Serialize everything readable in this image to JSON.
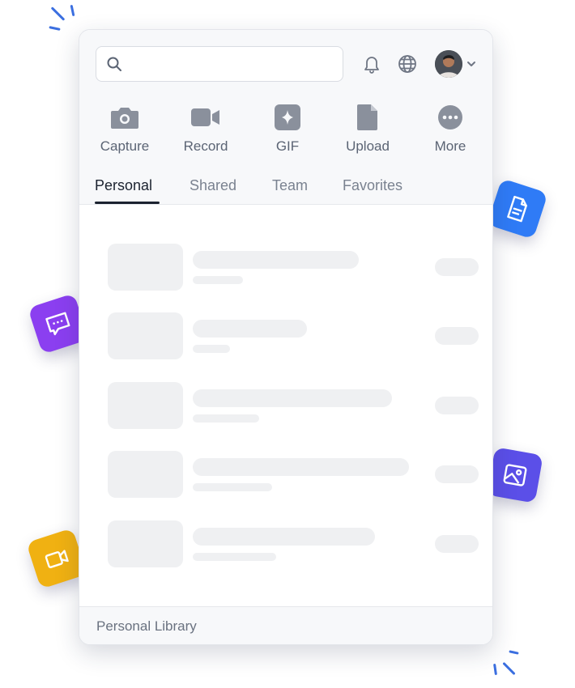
{
  "search": {
    "placeholder": "",
    "value": ""
  },
  "header": {
    "icons": [
      "bell-icon",
      "globe-icon",
      "user-avatar",
      "chevron-down-icon"
    ]
  },
  "actions": [
    {
      "label": "Capture",
      "icon": "camera-icon"
    },
    {
      "label": "Record",
      "icon": "video-camera-icon"
    },
    {
      "label": "GIF",
      "icon": "sparkle-icon"
    },
    {
      "label": "Upload",
      "icon": "file-icon"
    },
    {
      "label": "More",
      "icon": "more-dots-icon"
    }
  ],
  "tabs": [
    {
      "label": "Personal",
      "active": true
    },
    {
      "label": "Shared",
      "active": false
    },
    {
      "label": "Team",
      "active": false
    },
    {
      "label": "Favorites",
      "active": false
    }
  ],
  "list": {
    "state": "loading-skeleton",
    "row_count": 5
  },
  "footer": {
    "label": "Personal Library"
  },
  "floating_tiles": [
    {
      "icon": "document-icon",
      "color": "#2f7bf6"
    },
    {
      "icon": "chat-bubble-icon",
      "color": "#8b3ff0"
    },
    {
      "icon": "image-icon",
      "color": "#5b4fe8"
    },
    {
      "icon": "video-icon",
      "color": "#f0b112"
    }
  ],
  "colors": {
    "accent": "#1c2330",
    "icon_gray": "#8a909c",
    "skeleton": "#eff0f2"
  }
}
